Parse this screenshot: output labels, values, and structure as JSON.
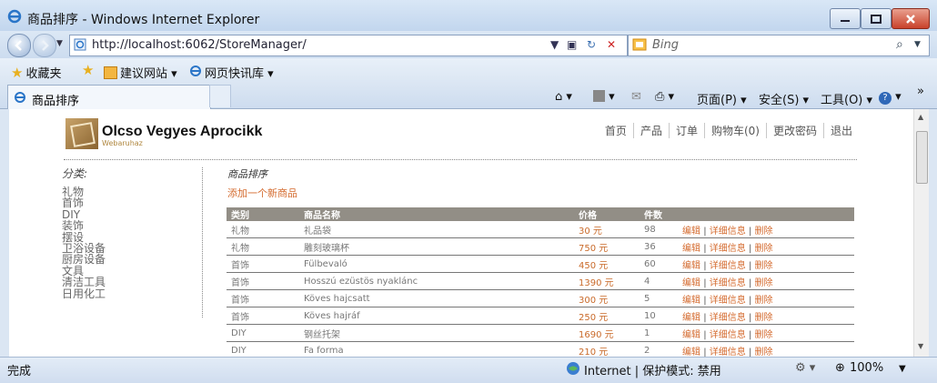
{
  "window": {
    "title": "商品排序 - Windows Internet Explorer"
  },
  "address": {
    "url": "http://localhost:6062/StoreManager/",
    "search_placeholder": "Bing"
  },
  "favorites": {
    "label": "收藏夹",
    "items": [
      "建议网站 ▾",
      "网页快讯库 ▾"
    ]
  },
  "tab": {
    "label": "商品排序"
  },
  "commands": {
    "page": "页面(P) ▾",
    "safety": "安全(S) ▾",
    "tools": "工具(O) ▾",
    "more": "»"
  },
  "site": {
    "logo_title": "Olcso Vegyes Aprocikk",
    "logo_sub": "Webaruhaz",
    "nav": [
      "首页",
      "产品",
      "订单",
      "购物车(0)",
      "更改密码",
      "退出"
    ]
  },
  "sidebar": {
    "heading": "分类:",
    "categories": [
      "礼物",
      "首饰",
      "DIY",
      "装饰",
      "摆设",
      "卫浴设备",
      "厨房设备",
      "文具",
      "清洁工具",
      "日用化工"
    ]
  },
  "main": {
    "title": "商品排序",
    "add_link": "添加一个新商品",
    "columns": [
      "类别",
      "商品名称",
      "价格",
      "件数",
      ""
    ],
    "rows": [
      {
        "cat": "礼物",
        "name": "礼品袋",
        "price": "30 元",
        "qty": "98"
      },
      {
        "cat": "礼物",
        "name": "雕刻玻璃杯",
        "price": "750 元",
        "qty": "36"
      },
      {
        "cat": "首饰",
        "name": "Fülbevaló",
        "price": "450 元",
        "qty": "60"
      },
      {
        "cat": "首饰",
        "name": "Hosszú ezüstös nyaklánc",
        "price": "1390 元",
        "qty": "4"
      },
      {
        "cat": "首饰",
        "name": "Köves hajcsatt",
        "price": "300 元",
        "qty": "5"
      },
      {
        "cat": "首饰",
        "name": "Köves hajráf",
        "price": "250 元",
        "qty": "10"
      },
      {
        "cat": "DIY",
        "name": "钢丝托架",
        "price": "1690 元",
        "qty": "1"
      },
      {
        "cat": "DIY",
        "name": "Fa forma",
        "price": "210 元",
        "qty": "2"
      }
    ],
    "actions": {
      "edit": "编辑",
      "detail": "详细信息",
      "delete": "删除",
      "sep": "|"
    }
  },
  "status": {
    "left": "完成",
    "zone": "Internet | 保护模式: 禁用",
    "zoom": "100%"
  },
  "colors": {
    "accent": "#d46b2f",
    "header_bg": "#928e86"
  }
}
